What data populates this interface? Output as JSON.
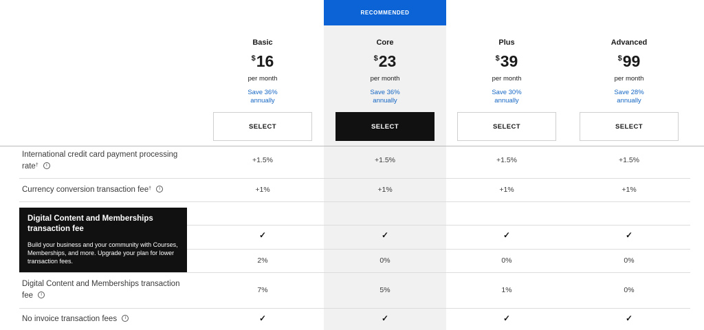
{
  "recommended_label": "RECOMMENDED",
  "plans": [
    {
      "name": "Basic",
      "currency": "$",
      "price": "16",
      "period": "per month",
      "save_line1": "Save 36%",
      "save_line2": "annually",
      "select_label": "SELECT"
    },
    {
      "name": "Core",
      "currency": "$",
      "price": "23",
      "period": "per month",
      "save_line1": "Save 36%",
      "save_line2": "annually",
      "select_label": "SELECT"
    },
    {
      "name": "Plus",
      "currency": "$",
      "price": "39",
      "period": "per month",
      "save_line1": "Save 30%",
      "save_line2": "annually",
      "select_label": "SELECT"
    },
    {
      "name": "Advanced",
      "currency": "$",
      "price": "99",
      "period": "per month",
      "save_line1": "Save 28%",
      "save_line2": "annually",
      "select_label": "SELECT"
    }
  ],
  "rows": {
    "intl_card": {
      "label_line1": "International credit card payment processing",
      "label_line2": "rate",
      "sup": "†",
      "values": [
        "+1.5%",
        "+1.5%",
        "+1.5%",
        "+1.5%"
      ]
    },
    "currency": {
      "label": "Currency conversion transaction fee",
      "sup": "†",
      "values": [
        "+1%",
        "+1%",
        "+1%",
        "+1%"
      ]
    },
    "check_row": {
      "values": [
        "✓",
        "✓",
        "✓",
        "✓"
      ]
    },
    "pct_row": {
      "values": [
        "2%",
        "0%",
        "0%",
        "0%"
      ]
    },
    "digital": {
      "label_line1": "Digital Content and Memberships transaction",
      "label_line2": "fee",
      "values": [
        "7%",
        "5%",
        "1%",
        "0%"
      ]
    },
    "invoice": {
      "label": "No invoice transaction fees",
      "values": [
        "✓",
        "✓",
        "✓",
        "✓"
      ]
    }
  },
  "tooltip": {
    "title": "Digital Content and Memberships transaction fee",
    "body": "Build your business and your community with Courses, Memberships, and more. Upgrade your plan for lower transaction fees."
  },
  "icons": {
    "info": "info-icon",
    "check": "check-icon"
  },
  "colors": {
    "recommended": "#0b63d6",
    "link": "#1466c4",
    "dark_button": "#111111",
    "highlight_col": "#f1f1f1"
  }
}
